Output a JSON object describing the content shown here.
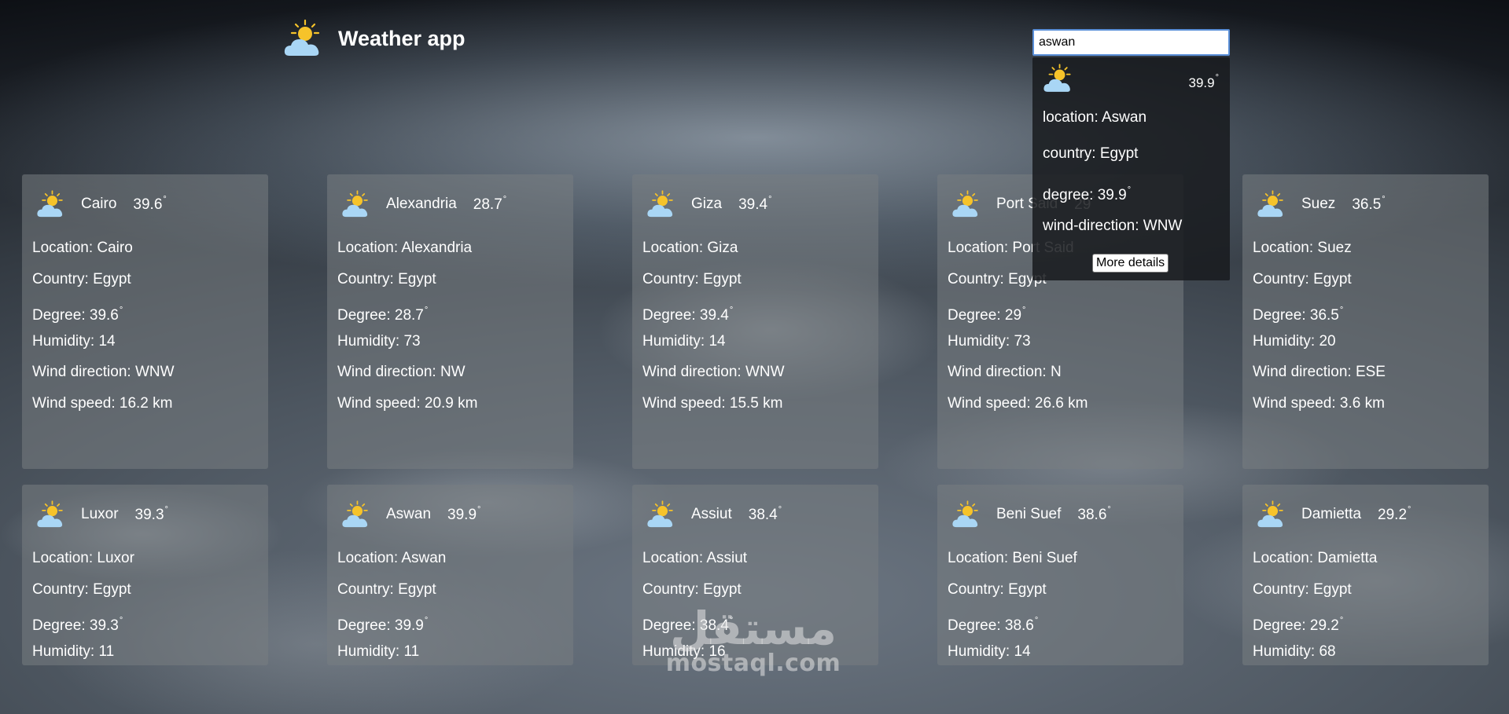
{
  "header": {
    "title": "Weather app",
    "icon": "partly-cloudy-icon"
  },
  "search": {
    "value": "aswan"
  },
  "colors": {
    "sun": "#f6c32a",
    "cloud": "#a9d6f5",
    "card_bg": "rgba(120,125,130,0.55)"
  },
  "cards": [
    {
      "city": "Cairo",
      "temp": "39.6",
      "lines": [
        "Location: Cairo",
        "Country: Egypt",
        "Degree: 39.6",
        "Humidity: 14",
        "Wind direction: WNW",
        "Wind speed: 16.2 km"
      ]
    },
    {
      "city": "Alexandria",
      "temp": "28.7",
      "lines": [
        "Location: Alexandria",
        "Country: Egypt",
        "Degree: 28.7",
        "Humidity: 73",
        "Wind direction: NW",
        "Wind speed: 20.9 km"
      ]
    },
    {
      "city": "Giza",
      "temp": "39.4",
      "lines": [
        "Location: Giza",
        "Country: Egypt",
        "Degree: 39.4",
        "Humidity: 14",
        "Wind direction: WNW",
        "Wind speed: 15.5 km"
      ]
    },
    {
      "city": "Port Said",
      "temp": "29",
      "lines": [
        "Location: Port Said",
        "Country: Egypt",
        "Degree: 29",
        "Humidity: 73",
        "Wind direction: N",
        "Wind speed: 26.6 km"
      ]
    },
    {
      "city": "Suez",
      "temp": "36.5",
      "lines": [
        "Location: Suez",
        "Country: Egypt",
        "Degree: 36.5",
        "Humidity: 20",
        "Wind direction: ESE",
        "Wind speed: 3.6 km"
      ]
    },
    {
      "city": "Luxor",
      "temp": "39.3",
      "lines": [
        "Location: Luxor",
        "Country: Egypt",
        "Degree: 39.3",
        "Humidity: 11"
      ]
    },
    {
      "city": "Aswan",
      "temp": "39.9",
      "lines": [
        "Location: Aswan",
        "Country: Egypt",
        "Degree: 39.9",
        "Humidity: 11"
      ]
    },
    {
      "city": "Assiut",
      "temp": "38.4",
      "lines": [
        "Location: Assiut",
        "Country: Egypt",
        "Degree: 38.4",
        "Humidity: 16"
      ]
    },
    {
      "city": "Beni Suef",
      "temp": "38.6",
      "lines": [
        "Location: Beni Suef",
        "Country: Egypt",
        "Degree: 38.6",
        "Humidity: 14"
      ]
    },
    {
      "city": "Damietta",
      "temp": "29.2",
      "lines": [
        "Location: Damietta",
        "Country: Egypt",
        "Degree: 29.2",
        "Humidity: 68"
      ]
    }
  ],
  "degree_mark": "°",
  "dropdown": {
    "temp": "39.9",
    "location": "location: Aswan",
    "country": "country: Egypt",
    "degree": "degree: 39.9",
    "wind": "wind-direction: WNW",
    "button": "More details"
  },
  "watermark": {
    "arabic": "مستقل",
    "latin": "mostaql.com"
  }
}
